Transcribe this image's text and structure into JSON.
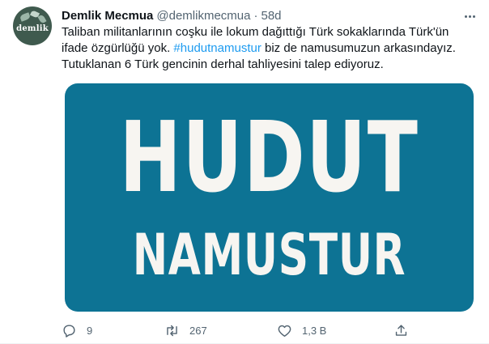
{
  "tweet": {
    "avatar_text": "demlik",
    "display_name": "Demlik Mecmua",
    "handle": "@demlikmecmua",
    "separator": "·",
    "time": "58d",
    "text_before_hashtag": "Taliban militanlarının coşku ile lokum dağıttığı Türk sokaklarında Türk'ün ifade özgürlüğü yok. ",
    "hashtag": "#hudutnamustur",
    "text_after_hashtag": " biz de namusumuzun arkasındayız. Tutuklanan 6 Türk gencinin derhal tahliyesini talep ediyoruz.",
    "image": {
      "line1": "HUDUT",
      "line2": "NAMUSTUR",
      "background_color": "#0d7394",
      "text_color": "#f7f5f1"
    }
  },
  "actions": {
    "reply": {
      "icon": "reply-icon",
      "count": "9"
    },
    "retweet": {
      "icon": "retweet-icon",
      "count": "267"
    },
    "like": {
      "icon": "heart-icon",
      "count": "1,3 B"
    },
    "share": {
      "icon": "share-icon"
    }
  },
  "colors": {
    "text_primary": "#0f1419",
    "text_secondary": "#536471",
    "link": "#1d9bf0"
  }
}
